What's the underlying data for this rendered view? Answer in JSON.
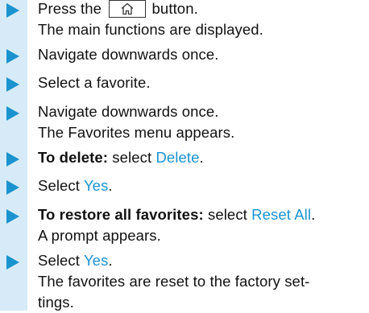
{
  "colors": {
    "accent": "#1a93cf",
    "sidebar": "#d6ebf7",
    "text": "#111111"
  },
  "steps": [
    {
      "part1": "Press the",
      "icon": "home-icon",
      "part2": "button.",
      "result": "The main functions are displayed."
    },
    {
      "text": "Navigate downwards once."
    },
    {
      "text": "Select a favorite."
    },
    {
      "text": "Navigate downwards once.",
      "result": "The Favorites menu appears."
    },
    {
      "bold": "To delete:",
      "text": "select",
      "link": "Delete",
      "tail": "."
    },
    {
      "text": "Select",
      "link": "Yes",
      "tail": "."
    },
    {
      "bold": "To restore all favorites:",
      "text": "select",
      "link": "Reset All",
      "tail": ".",
      "result": "A prompt appears."
    },
    {
      "text": "Select",
      "link": "Yes",
      "tail": ".",
      "result_line1": "The favorites are reset to the factory set-",
      "result_line2": "tings."
    }
  ]
}
